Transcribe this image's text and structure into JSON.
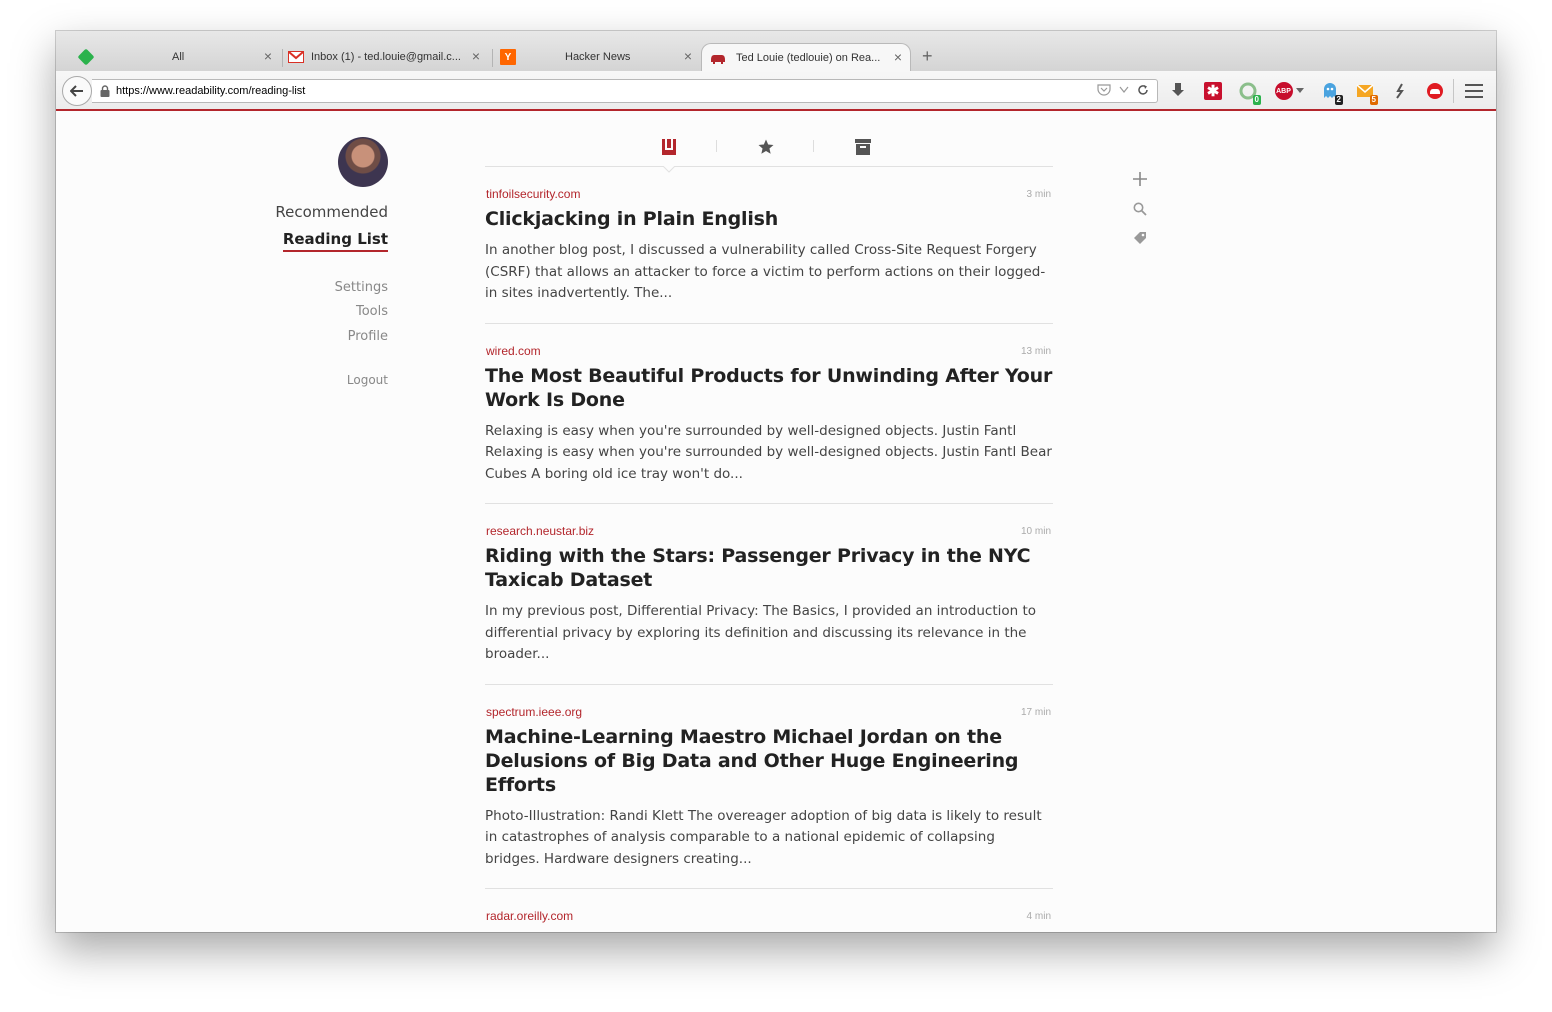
{
  "browser": {
    "tabs": [
      {
        "label": "All",
        "icon": "feedly-icon",
        "color": "#2bb24c"
      },
      {
        "label": "Inbox (1) - ted.louie@gmail.c...",
        "icon": "gmail-icon",
        "color": "#d93025"
      },
      {
        "label": "Hacker News",
        "icon": "hacker-news-icon",
        "color": "#ff6600"
      },
      {
        "label": "Ted Louie (tedlouie) on Rea...",
        "icon": "readability-icon",
        "color": "#b3262c"
      }
    ],
    "url": "https://www.readability.com/reading-list",
    "extension_badges": {
      "green": "0",
      "ghostery": "2",
      "mail": "5"
    }
  },
  "sidebar": {
    "recommended": "Recommended",
    "reading_list": "Reading List",
    "settings": "Settings",
    "tools": "Tools",
    "profile": "Profile",
    "logout": "Logout"
  },
  "articles": [
    {
      "domain": "tinfoilsecurity.com",
      "time": "3 min",
      "title": "Clickjacking in Plain English",
      "excerpt": "In another blog post, I discussed a vulnerability called Cross-Site Request Forgery (CSRF) that allows an attacker to force a victim to perform actions on their logged-in sites inadvertently. The..."
    },
    {
      "domain": "wired.com",
      "time": "13 min",
      "title": "The Most Beautiful Products for Unwinding After Your Work Is Done",
      "excerpt": "Relaxing is easy when you're surrounded by well-designed objects. Justin Fantl Relaxing is easy when you're surrounded by well-designed objects. Justin Fantl Bear Cubes A boring old ice tray won't do..."
    },
    {
      "domain": "research.neustar.biz",
      "time": "10 min",
      "title": "Riding with the Stars: Passenger Privacy in the NYC Taxicab Dataset",
      "excerpt": "In my previous post, Differential Privacy: The Basics, I provided an introduction to differential privacy by exploring its definition and discussing its relevance in the broader..."
    },
    {
      "domain": "spectrum.ieee.org",
      "time": "17 min",
      "title": "Machine-Learning Maestro Michael Jordan on the Delusions of Big Data and Other Huge Engineering Efforts",
      "excerpt": "Photo-Illustration: Randi Klett The overeager adoption of big data is likely to result in catastrophes of analysis comparable to a national epidemic of collapsing bridges. Hardware designers creating..."
    },
    {
      "domain": "radar.oreilly.com",
      "time": "4 min",
      "title": "",
      "excerpt": ""
    }
  ],
  "colors": {
    "accent": "#b3262c",
    "text": "#222222",
    "muted": "#888888"
  }
}
